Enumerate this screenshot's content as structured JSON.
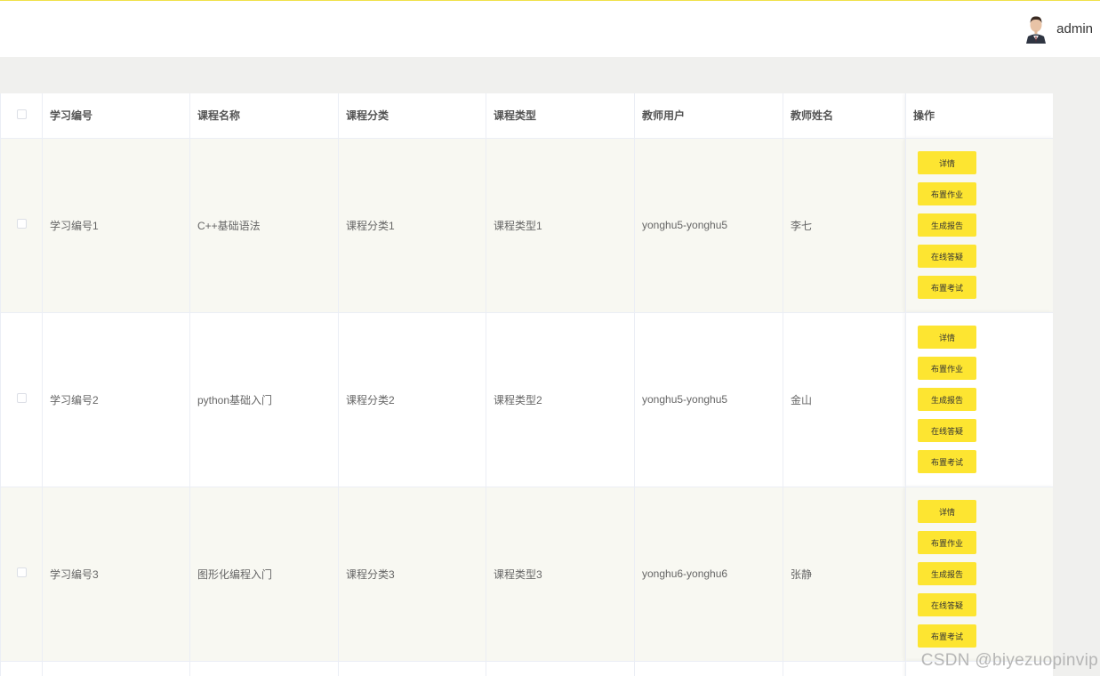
{
  "header": {
    "username": "admin"
  },
  "table": {
    "columns": [
      "学习编号",
      "课程名称",
      "课程分类",
      "课程类型",
      "教师用户",
      "教师姓名",
      "操作"
    ],
    "rows": [
      {
        "study_no": "学习编号1",
        "course_name": "C++基础语法",
        "category": "课程分类1",
        "type": "课程类型1",
        "teacher_user": "yonghu5-yonghu5",
        "teacher_name": "李七"
      },
      {
        "study_no": "学习编号2",
        "course_name": "python基础入门",
        "category": "课程分类2",
        "type": "课程类型2",
        "teacher_user": "yonghu5-yonghu5",
        "teacher_name": "金山"
      },
      {
        "study_no": "学习编号3",
        "course_name": "图形化编程入门",
        "category": "课程分类3",
        "type": "课程类型3",
        "teacher_user": "yonghu6-yonghu6",
        "teacher_name": "张静"
      }
    ],
    "actions": [
      "详情",
      "布置作业",
      "生成报告",
      "在线答疑",
      "布置考试"
    ]
  },
  "watermark": "CSDN @biyezuopinvip",
  "colors": {
    "accent": "#fde531",
    "stripe": "#f8f8f2",
    "page_bg": "#f0f0ee"
  }
}
